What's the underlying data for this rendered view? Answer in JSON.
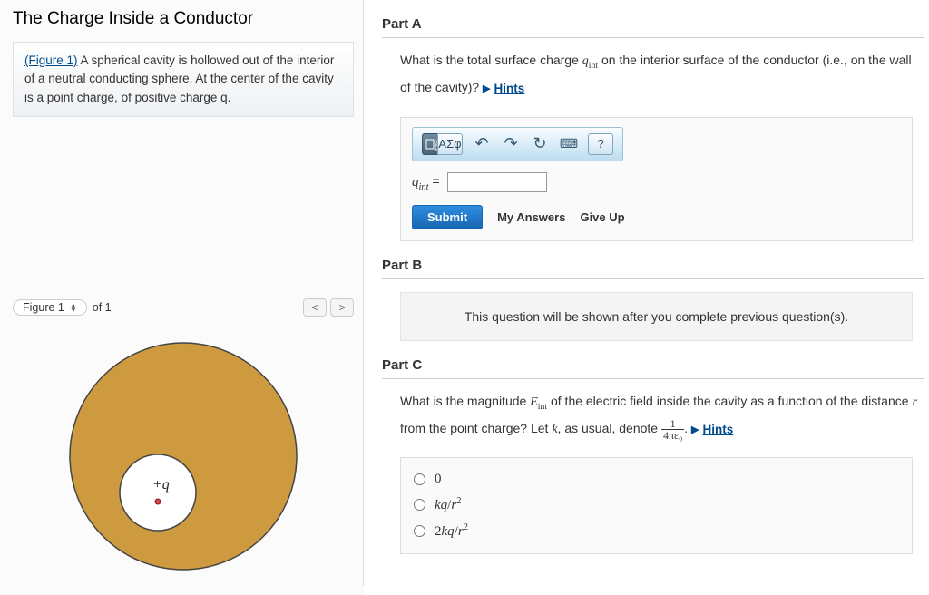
{
  "title": "The Charge Inside a Conductor",
  "problem": {
    "fig_link": "(Figure 1)",
    "text": " A spherical cavity is hollowed out of the interior of a neutral conducting sphere. At the center of the cavity is a point charge, of positive charge q."
  },
  "figure": {
    "selector": "Figure 1",
    "of_label": "of 1",
    "prev": "<",
    "next": ">",
    "charge_label": "+q"
  },
  "partA": {
    "header": "Part A",
    "question_pre": "What is the total surface charge ",
    "q_symbol": "q",
    "q_sub": "int",
    "question_post": " on the interior surface of the conductor (i.e., on the wall of the cavity)?",
    "hints": "Hints",
    "tool_sigma": "ΑΣφ",
    "tool_help": "?",
    "label": "q",
    "label_sub": "int",
    "eq": " = ",
    "submit": "Submit",
    "my_answers": "My Answers",
    "give_up": "Give Up"
  },
  "partB": {
    "header": "Part B",
    "locked": "This question will be shown after you complete previous question(s)."
  },
  "partC": {
    "header": "Part C",
    "q1": "What is the magnitude ",
    "E": "E",
    "E_sub": "int",
    "q2": " of the electric field inside the cavity as a function of the distance ",
    "r": "r",
    "q3": " from the point charge? Let ",
    "k": "k",
    "q4": ", as usual, denote ",
    "frac_top": "1",
    "frac_bot": "4πε₀",
    "q5": ".",
    "hints": "Hints",
    "options": [
      "0",
      "kq/r²",
      "2kq/r²"
    ]
  }
}
